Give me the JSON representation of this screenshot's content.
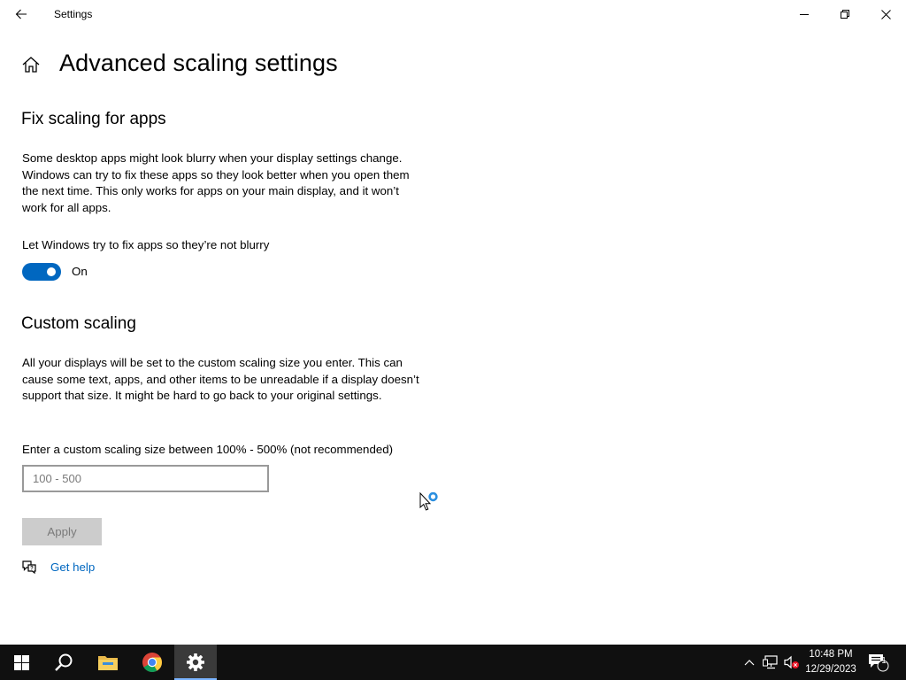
{
  "window": {
    "title": "Settings"
  },
  "header": {
    "page_title": "Advanced scaling settings"
  },
  "fix_scaling": {
    "title": "Fix scaling for apps",
    "description": "Some desktop apps might look blurry when your display settings change. Windows can try to fix these apps so they look better when you open them the next time. This only works for apps on your main display, and it won’t work for all apps.",
    "toggle_label": "Let Windows try to fix apps so they’re not blurry",
    "toggle_state": "On"
  },
  "custom_scaling": {
    "title": "Custom scaling",
    "description": "All your displays will be set to the custom scaling size you enter. This can cause some text, apps, and other items to be unreadable if a display doesn’t support that size. It might be hard to go back to your original settings.",
    "input_label": "Enter a custom scaling size between 100% - 500% (not recommended)",
    "input_placeholder": "100 - 500",
    "input_value": "",
    "apply_label": "Apply"
  },
  "help": {
    "link_label": "Get help"
  },
  "taskbar": {
    "apps": [
      "start-icon",
      "search-icon",
      "file-explorer-icon",
      "chrome-icon",
      "settings-icon"
    ],
    "clock_time": "10:48 PM",
    "clock_date": "12/29/2023",
    "notification_count": "1"
  },
  "colors": {
    "accent": "#0067c0",
    "taskbar": "#101010"
  }
}
